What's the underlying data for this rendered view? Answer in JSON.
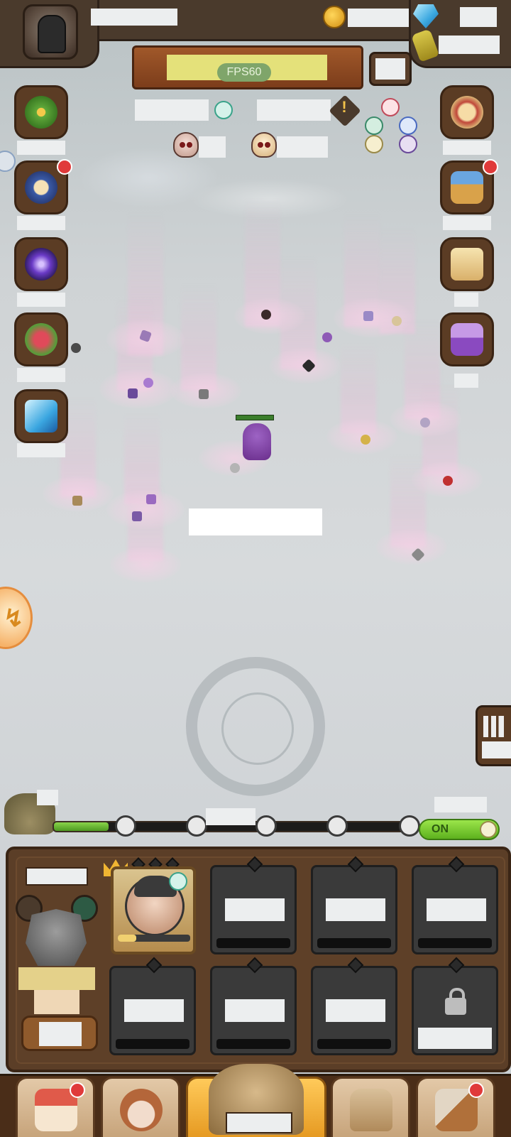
{
  "hud": {
    "fps_label": "FPS60",
    "auto_toggle_label": "ON",
    "auto_toggle_state": "on",
    "stage_progress_fraction": 0.15,
    "hero_xp_fraction": 0.25
  },
  "icons": {
    "top_left": "knight-helmet-avatar-icon",
    "coin": "gold-coin-icon",
    "gem": "blue-gem-icon",
    "potion": "potion-jar-icon",
    "left_side": [
      "clover-icon",
      "event-scroll-icon",
      "vortex-portal-icon",
      "rose-bouquet-icon",
      "crystal-gem-icon"
    ],
    "right_side": [
      "quest-scroll-icon",
      "treasure-chest-icon",
      "checklist-board-icon",
      "purple-chest-icon"
    ],
    "bottom_nav": [
      "shop-icon",
      "hero-icon",
      "adventure-map-icon",
      "inventory-bag-icon",
      "forge-hammer-icon"
    ]
  },
  "colors": {
    "wood_dark": "#4a3a2c",
    "toggle_green": "#5db11e",
    "progress_green": "#4e9a22",
    "badge_red": "#e03a3a",
    "fps_pill": "#7fa56a"
  }
}
